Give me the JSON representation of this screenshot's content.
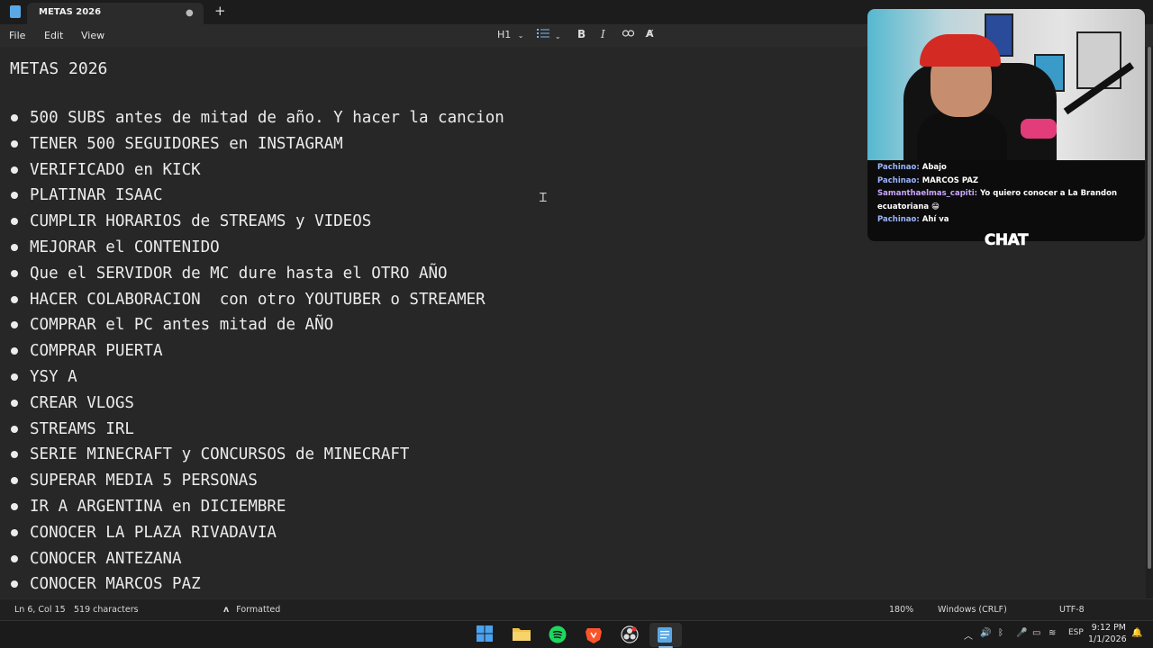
{
  "window": {
    "tab_title": "METAS 2026",
    "tab_modified_dot": "●",
    "new_tab_glyph": "+"
  },
  "menu": {
    "file": "File",
    "edit": "Edit",
    "view": "View"
  },
  "toolbar": {
    "heading": "H1",
    "bold": "B",
    "italic": "I"
  },
  "document": {
    "title": "METAS 2026",
    "items": [
      "500 SUBS antes de mitad de año. Y hacer la cancion",
      "TENER 500 SEGUIDORES en INSTAGRAM",
      "VERIFICADO en KICK",
      "PLATINAR ISAAC",
      "CUMPLIR HORARIOS de STREAMS y VIDEOS",
      "MEJORAR el CONTENIDO",
      "Que el SERVIDOR de MC dure hasta el OTRO AÑO",
      "HACER COLABORACION  con otro YOUTUBER o STREAMER",
      "COMPRAR el PC antes mitad de AÑO",
      "COMPRAR PUERTA",
      "YSY A",
      "CREAR VLOGS",
      "STREAMS IRL",
      "SERIE MINECRAFT y CONCURSOS de MINECRAFT",
      "SUPERAR MEDIA 5 PERSONAS",
      "IR A ARGENTINA en DICIEMBRE",
      "CONOCER LA PLAZA RIVADAVIA",
      "CONOCER ANTEZANA",
      "CONOCER MARCOS PAZ"
    ]
  },
  "status": {
    "position": "Ln 6, Col 15",
    "characters": "519 characters",
    "format": "Formatted",
    "zoom": "180%",
    "line_endings": "Windows (CRLF)",
    "encoding": "UTF-8"
  },
  "taskbar": {
    "language": "ESP",
    "time": "9:12 PM",
    "date": "1/1/2026"
  },
  "stream_overlay": {
    "chat": [
      {
        "user": "Pachinao:",
        "text": "Abajo"
      },
      {
        "user": "Pachinao:",
        "text": "MARCOS PAZ"
      },
      {
        "user": "Samanthaelmas_capiti:",
        "text": "Yo quiero conocer a La Brandon"
      },
      {
        "user": "",
        "text": "ecuatoriana 😁"
      },
      {
        "user": "Pachinao:",
        "text": "Ahí va"
      }
    ],
    "label": "CHAT"
  },
  "colors": {
    "background": "#202020",
    "editor": "#272727",
    "accent": "#7cb9f0"
  }
}
